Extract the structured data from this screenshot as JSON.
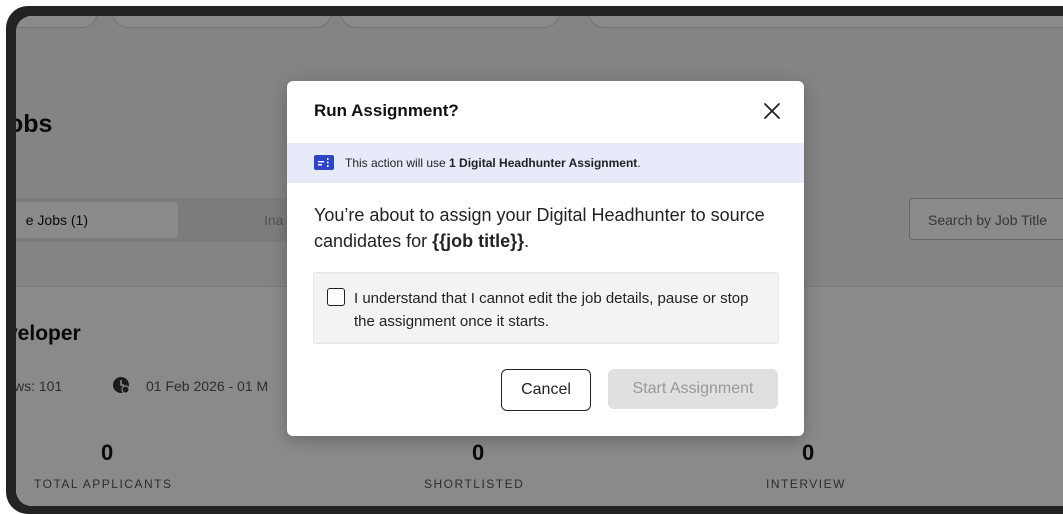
{
  "page": {
    "title": "obs",
    "tabs": [
      {
        "label": "e Jobs (1)"
      },
      {
        "label": "Ina"
      }
    ],
    "search_placeholder": "Search by Job Title",
    "job": {
      "title": "veloper",
      "views": "ws: 101",
      "date_range": "01 Feb 2026 - 01 M"
    },
    "stats": [
      {
        "value": "0",
        "label": "TOTAL APPLICANTS"
      },
      {
        "value": "0",
        "label": "SHORTLISTED"
      },
      {
        "value": "0",
        "label": "INTERVIEW"
      }
    ]
  },
  "modal": {
    "title": "Run Assignment?",
    "banner": {
      "prefix": "This action will use ",
      "bold": "1 Digital Headhunter Assignment",
      "suffix": "."
    },
    "body_prefix": "You’re about to assign your Digital Headhunter to source candidates for ",
    "body_bold": "{{job title}}",
    "body_suffix": ".",
    "checkbox_label": "I understand that I cannot edit the job details, pause or stop the assignment once it starts.",
    "checkbox_checked": false,
    "cancel_label": "Cancel",
    "start_label": "Start Assignment"
  },
  "colors": {
    "banner_bg": "#e7eaf8",
    "ticket_icon": "#2f45c9",
    "disabled_button": "#e0e0e0"
  }
}
